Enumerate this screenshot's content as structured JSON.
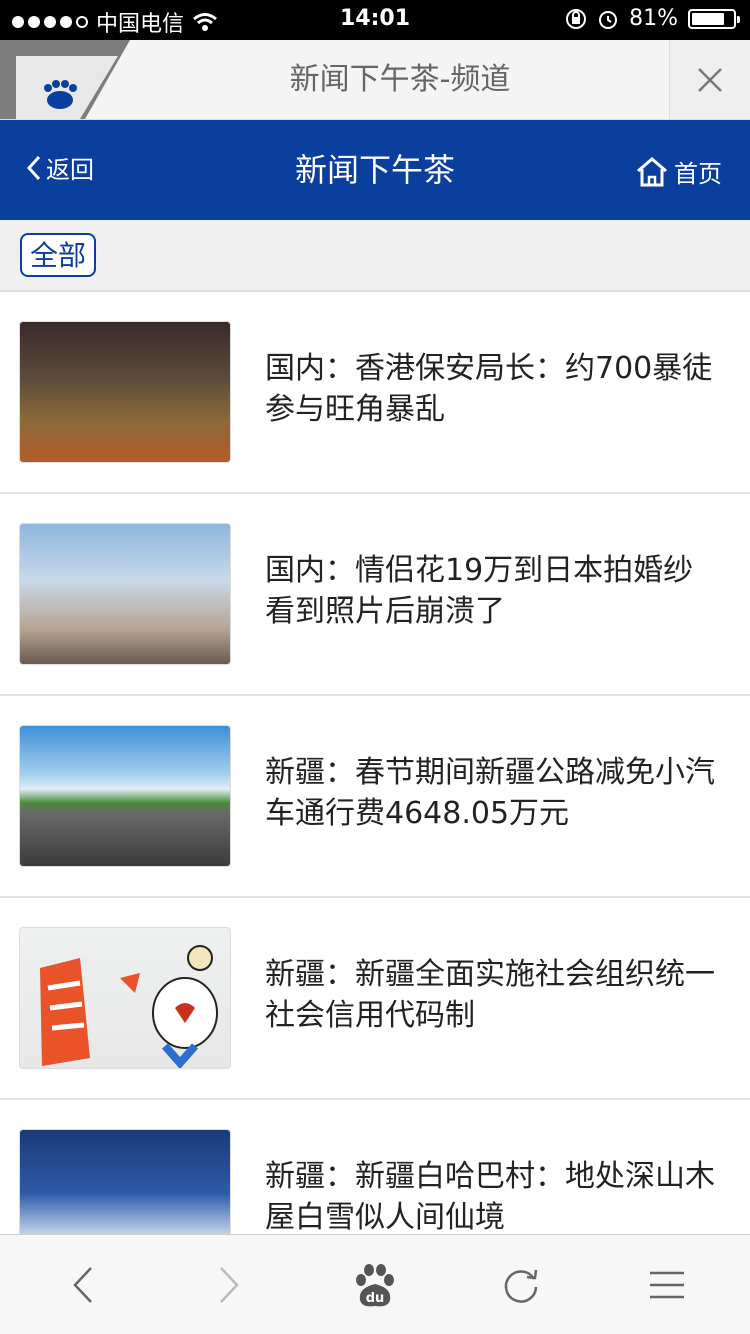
{
  "status_bar": {
    "carrier": "中国电信",
    "time": "14:01",
    "battery": "81%",
    "battery_level": 0.81
  },
  "browser_bar": {
    "title": "新闻下午茶-频道",
    "close_icon": "close-icon"
  },
  "header": {
    "back_label": "返回",
    "title": "新闻下午茶",
    "home_label": "首页",
    "bg_color": "#0a3f9e"
  },
  "filter": {
    "chip_label": "全部"
  },
  "news": [
    {
      "text": "国内：香港保安局长：约700暴徒参与旺角暴乱"
    },
    {
      "text": "国内：情侣花19万到日本拍婚纱看到照片后崩溃了"
    },
    {
      "text": "新疆：春节期间新疆公路减免小汽车通行费4648.05万元"
    },
    {
      "text": "新疆：新疆全面实施社会组织统一社会信用代码制"
    },
    {
      "text": "新疆：新疆白哈巴村：地处深山木屋白雪似人间仙境"
    }
  ],
  "toolbar": {
    "icons": [
      "back-arrow-icon",
      "forward-arrow-icon",
      "baidu-paw-icon",
      "refresh-icon",
      "menu-icon"
    ]
  }
}
